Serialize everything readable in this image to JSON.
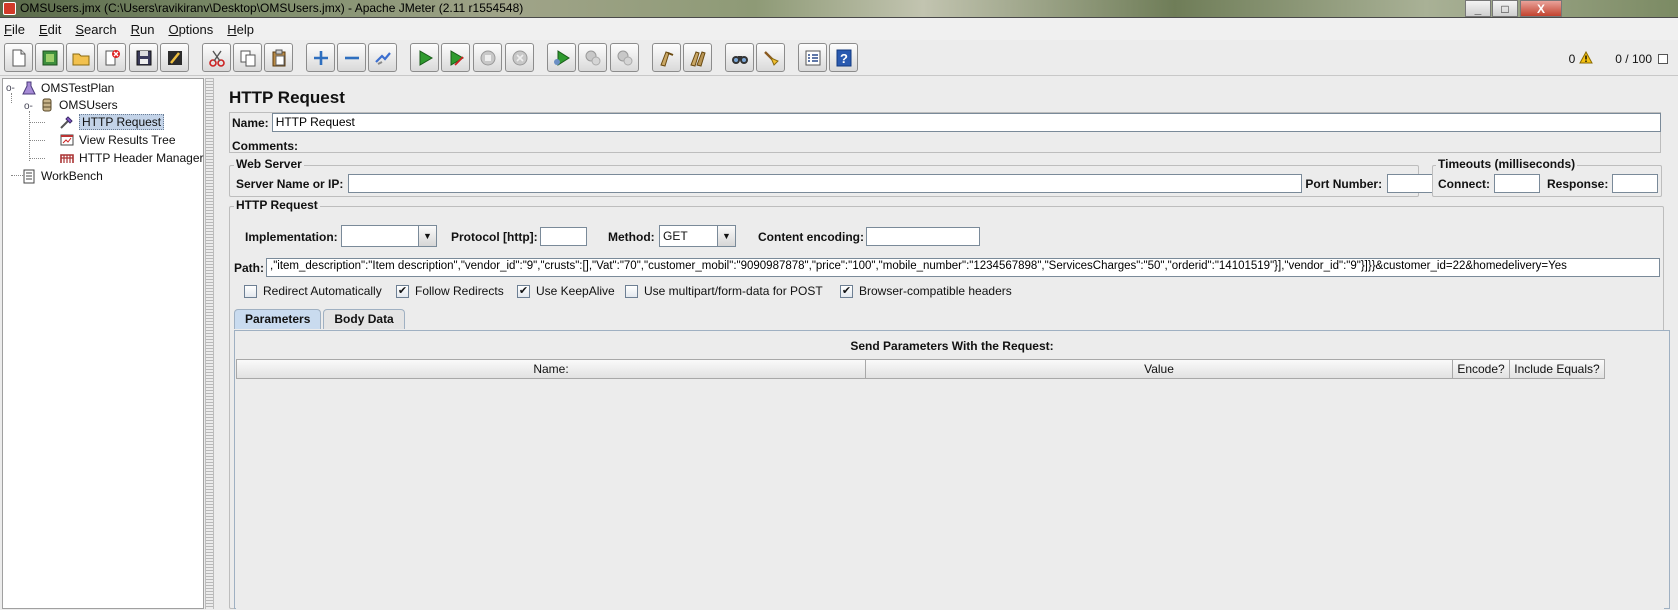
{
  "window": {
    "title": "OMSUsers.jmx (C:\\Users\\ravikiranv\\Desktop\\OMSUsers.jmx) - Apache JMeter (2.11 r1554548)",
    "minimize": "_",
    "maximize": "□",
    "close": "X"
  },
  "menu": [
    {
      "pre": "",
      "u": "F",
      "post": "ile"
    },
    {
      "pre": "",
      "u": "E",
      "post": "dit"
    },
    {
      "pre": "",
      "u": "S",
      "post": "earch"
    },
    {
      "pre": "",
      "u": "R",
      "post": "un"
    },
    {
      "pre": "",
      "u": "O",
      "post": "ptions"
    },
    {
      "pre": "",
      "u": "H",
      "post": "elp"
    }
  ],
  "toolbar_status": {
    "warning_count": "0",
    "threads": "0 / 100"
  },
  "tree": {
    "test_plan": "OMSTestPlan",
    "thread_group": "OMSUsers",
    "http_request": "HTTP Request",
    "view_results_tree": "View Results Tree",
    "header_manager": "HTTP Header Manager",
    "workbench": "WorkBench"
  },
  "main": {
    "title": "HTTP Request",
    "name_label": "Name:",
    "name_value": "HTTP Request",
    "comments_label": "Comments:",
    "comments_value": "",
    "web_server": {
      "legend": "Web Server",
      "server_label": "Server Name or IP:",
      "server_value": "",
      "port_label": "Port Number:",
      "port_value": ""
    },
    "timeouts": {
      "legend": "Timeouts (milliseconds)",
      "connect_label": "Connect:",
      "connect_value": "",
      "response_label": "Response:",
      "response_value": ""
    },
    "http_request_group": {
      "legend": "HTTP Request",
      "implementation_label": "Implementation:",
      "implementation_value": "",
      "protocol_label": "Protocol [http]:",
      "protocol_value": "",
      "method_label": "Method:",
      "method_value": "GET",
      "encoding_label": "Content encoding:",
      "encoding_value": "",
      "path_label": "Path:",
      "path_value": ",\"item_description\":\"Item description\",\"vendor_id\":\"9\",\"crusts\":[],\"Vat\":\"70\",\"customer_mobil\":\"9090987878\",\"price\":\"100\",\"mobile_number\":\"1234567898\",\"ServicesCharges\":\"50\",\"orderid\":\"14101519\"}],\"vendor_id\":\"9\"}]}}&customer_id=22&homedelivery=Yes"
    },
    "checkboxes": [
      {
        "label": "Redirect Automatically",
        "checked": false
      },
      {
        "label": "Follow Redirects",
        "checked": true
      },
      {
        "label": "Use KeepAlive",
        "checked": true
      },
      {
        "label": "Use multipart/form-data for POST",
        "checked": false
      },
      {
        "label": "Browser-compatible headers",
        "checked": true
      }
    ],
    "tabs": [
      "Parameters",
      "Body Data"
    ],
    "params": {
      "title": "Send Parameters With the Request:",
      "columns": [
        "Name:",
        "Value",
        "Encode?",
        "Include Equals?"
      ]
    }
  }
}
